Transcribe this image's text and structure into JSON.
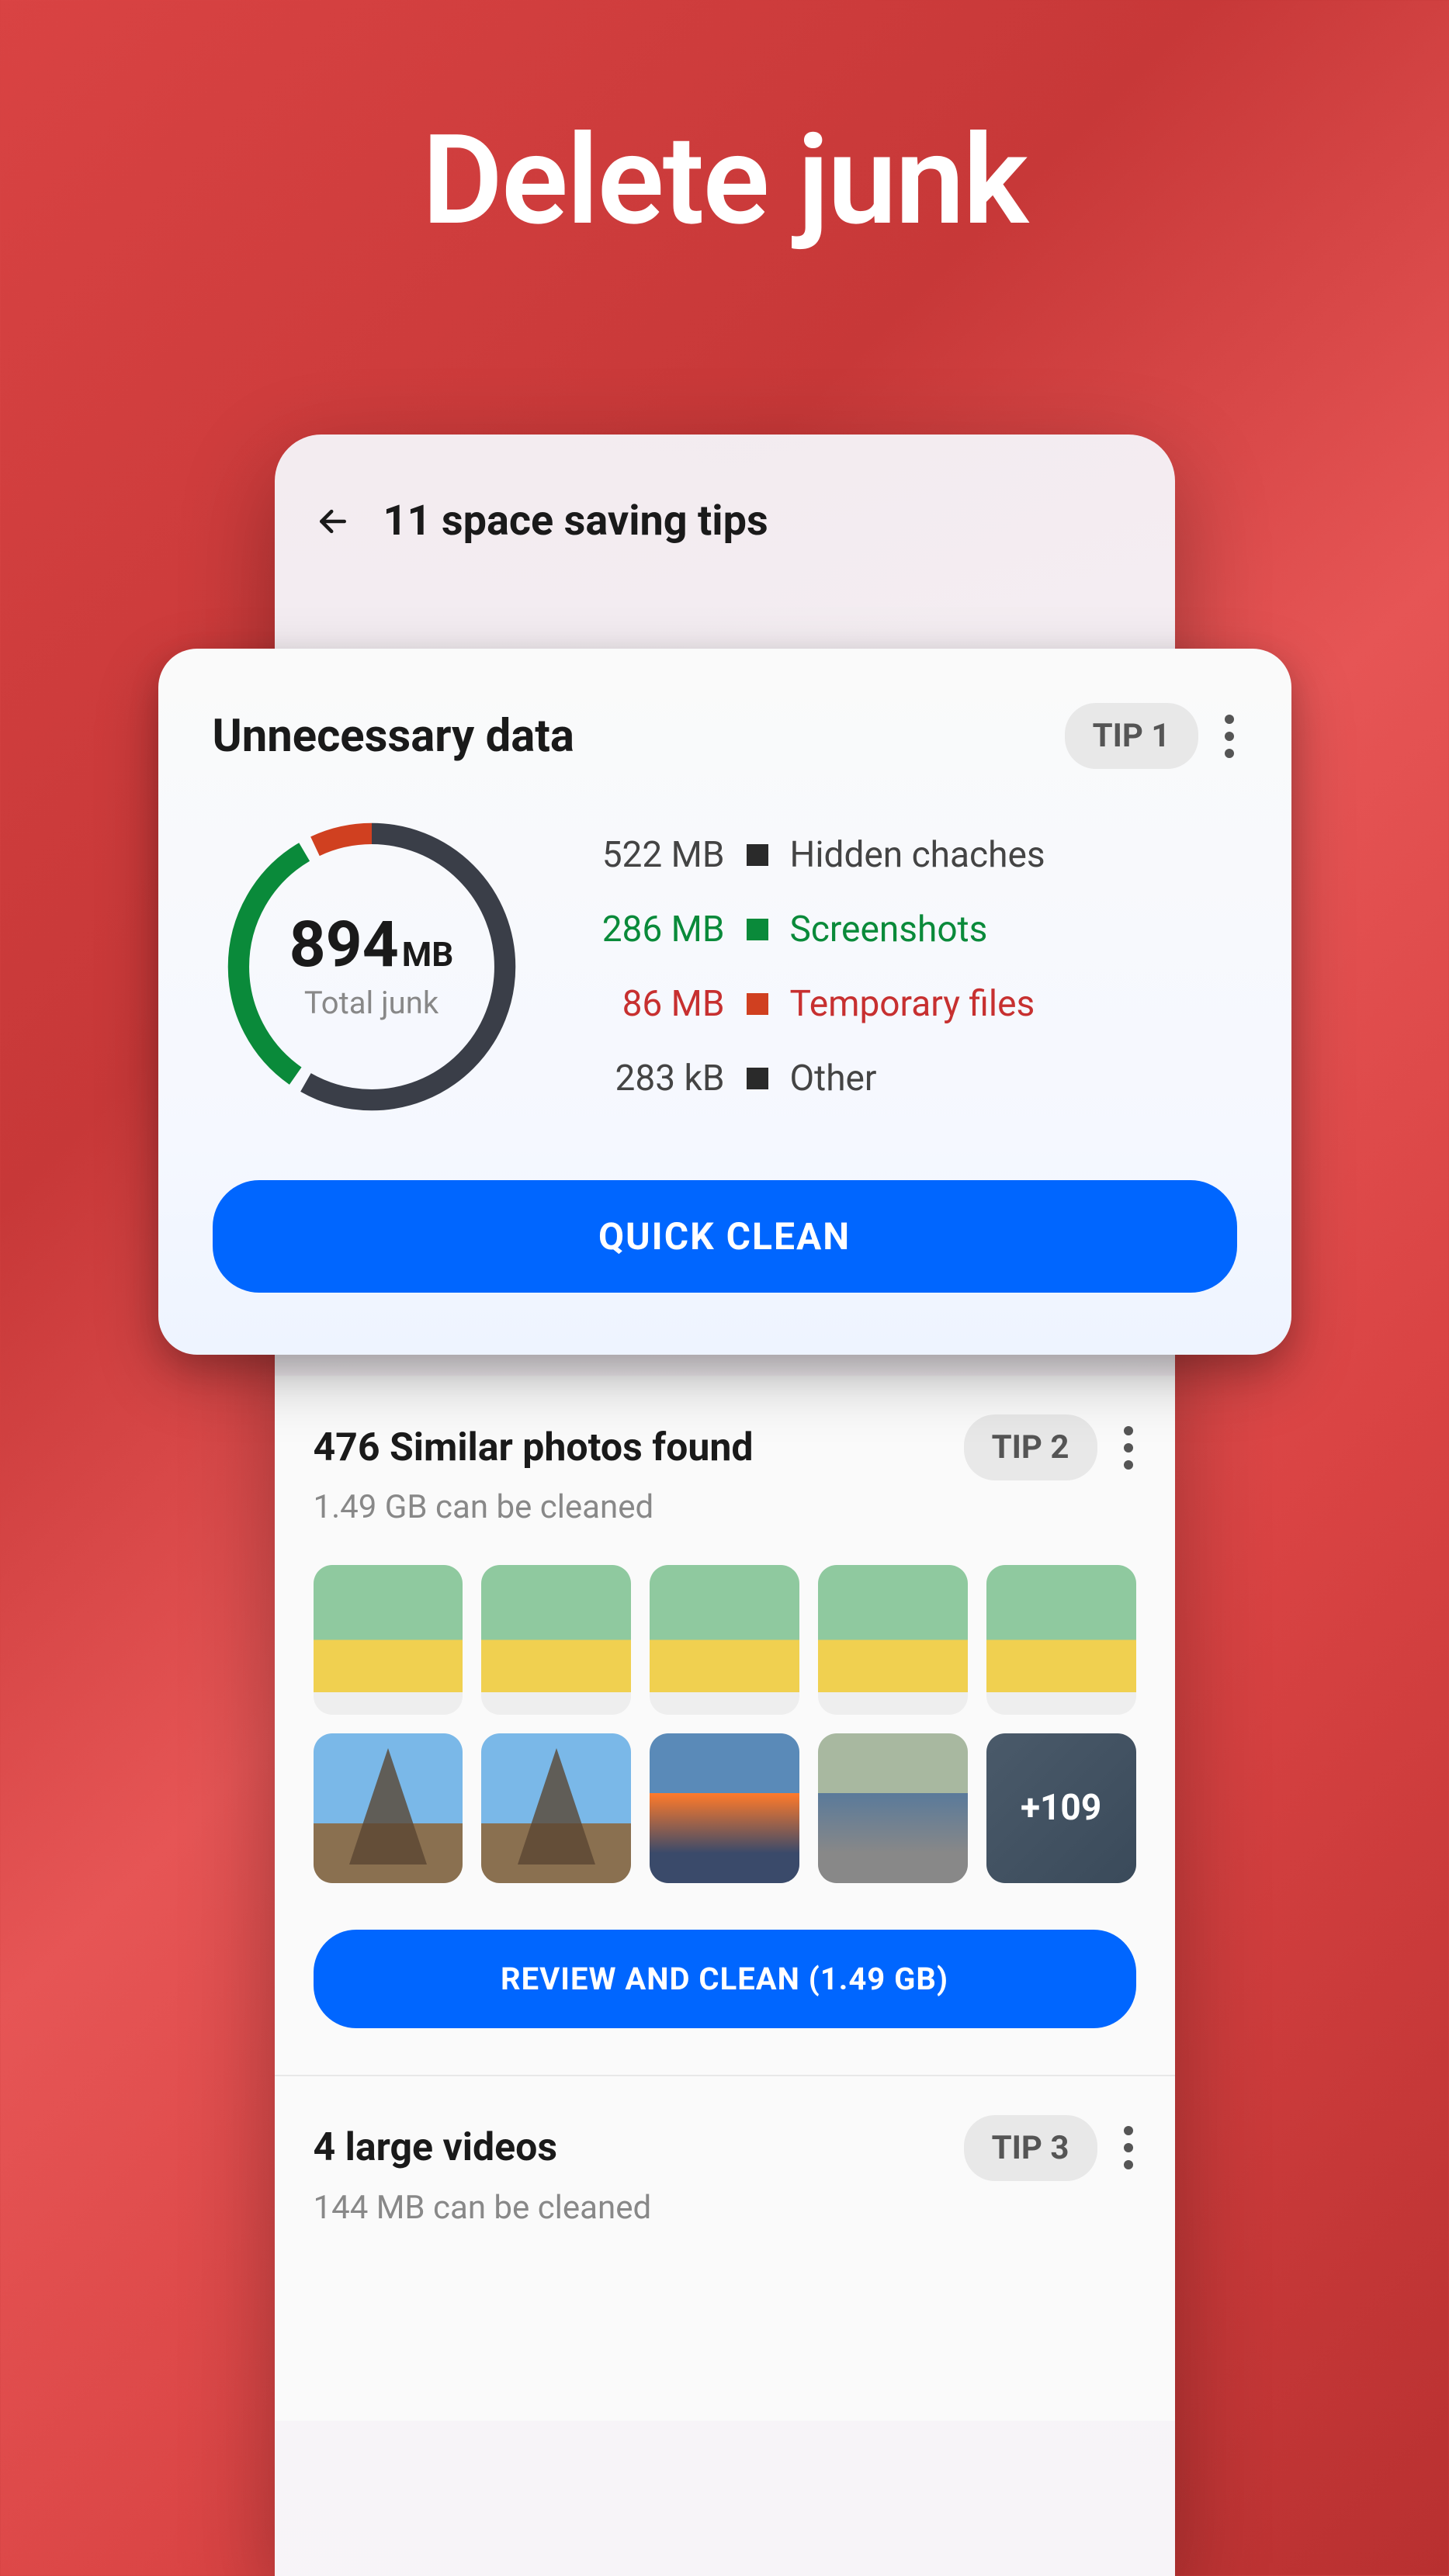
{
  "headline": "Delete junk",
  "appBar": {
    "title": "11 space saving tips"
  },
  "featuredCard": {
    "title": "Unnecessary data",
    "tipBadge": "TIP 1",
    "donut": {
      "value": "894",
      "unit": "MB",
      "label": "Total junk"
    },
    "categories": [
      {
        "size": "522 MB",
        "name": "Hidden chaches",
        "color": "#2a2a2a",
        "style": ""
      },
      {
        "size": "286 MB",
        "name": "Screenshots",
        "color": "#0a8a3a",
        "style": "cat-green"
      },
      {
        "size": "86 MB",
        "name": "Temporary files",
        "color": "#d04020",
        "style": "cat-red"
      },
      {
        "size": "283 kB",
        "name": "Other",
        "color": "#2a2a2a",
        "style": ""
      }
    ],
    "button": "QUICK CLEAN"
  },
  "tipCards": [
    {
      "title": "476 Similar photos found",
      "tipBadge": "TIP 2",
      "subtitle": "1.49 GB can be cleaned",
      "moreLabel": "+109",
      "button": "REVIEW AND CLEAN (1.49 GB)"
    },
    {
      "title": "4 large videos",
      "tipBadge": "TIP 3",
      "subtitle": "144 MB can be cleaned"
    }
  ]
}
